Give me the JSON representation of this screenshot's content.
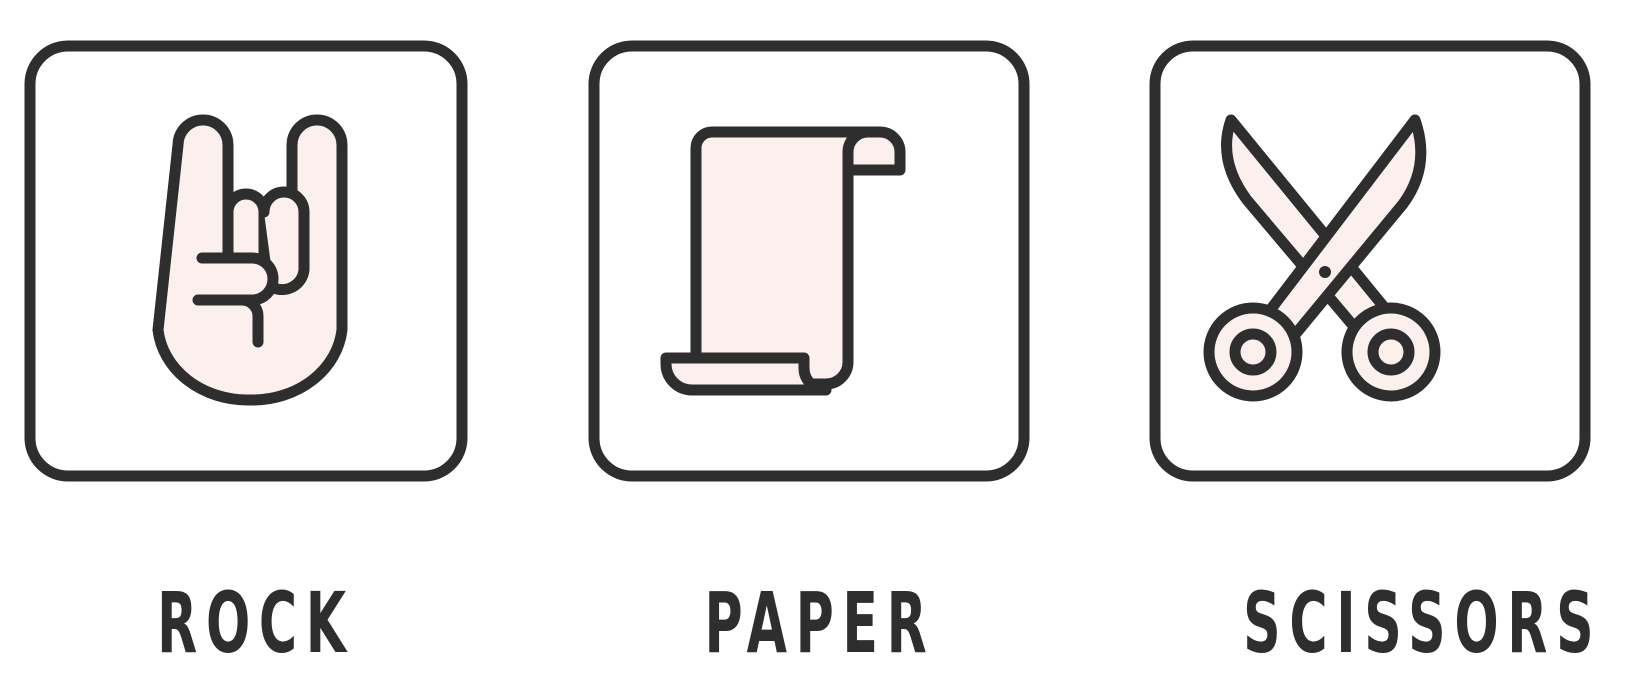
{
  "choices": [
    {
      "id": "rock",
      "label": "ROCK",
      "icon": "rock-hand-icon"
    },
    {
      "id": "paper",
      "label": "PAPER",
      "icon": "paper-scroll-icon"
    },
    {
      "id": "scissors",
      "label": "SCISSORS",
      "icon": "scissors-icon"
    }
  ],
  "colors": {
    "outline": "#2e2e2e",
    "fill": "#fbf0ee",
    "background": "#ffffff"
  }
}
